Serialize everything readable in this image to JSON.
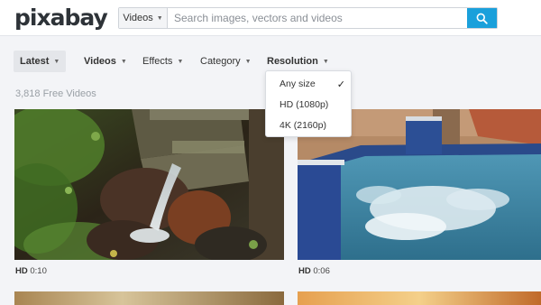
{
  "header": {
    "logo": "pixabay",
    "search": {
      "type_selected": "Videos",
      "placeholder": "Search images, vectors and videos"
    }
  },
  "filters": {
    "latest": "Latest",
    "videos": "Videos",
    "effects": "Effects",
    "category": "Category",
    "resolution": "Resolution"
  },
  "result_count": "3,818 Free Videos",
  "resolution_menu": {
    "items": [
      "Any size",
      "HD (1080p)",
      "4K (2160p)"
    ],
    "checked": "Any size"
  },
  "videos": [
    {
      "quality": "HD",
      "duration": "0:10",
      "subject": "stream over mossy rocks and wooden steps"
    },
    {
      "quality": "HD",
      "duration": "0:06",
      "subject": "bubbling hot tub beside a tiled pool"
    }
  ],
  "colors": {
    "accent": "#1aa0db",
    "header_bg": "#ffffff",
    "page_bg": "#f3f4f7"
  }
}
